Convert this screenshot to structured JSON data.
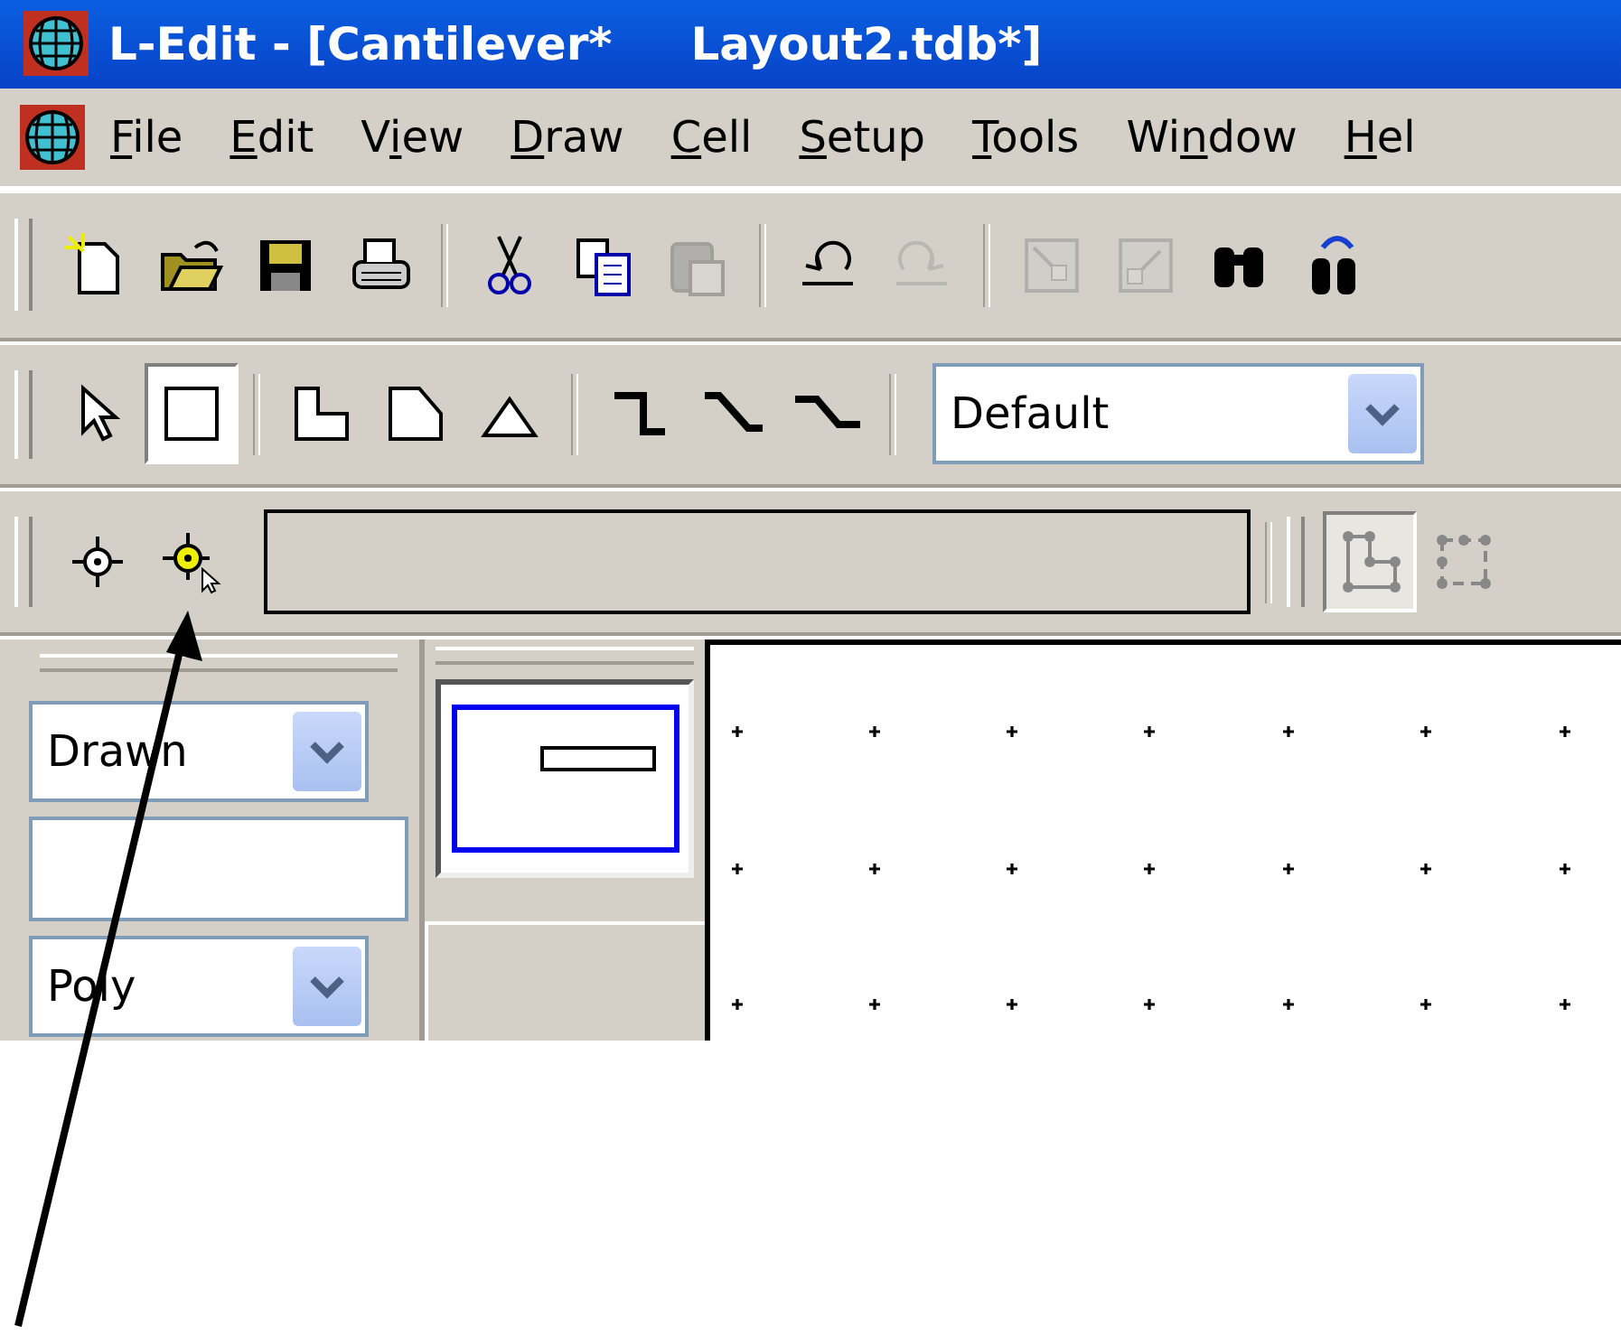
{
  "window": {
    "title": "L-Edit - [Cantilever*     Layout2.tdb*]"
  },
  "menu": [
    {
      "key": "F",
      "after": "ile"
    },
    {
      "key": "E",
      "after": "dit"
    },
    {
      "before": "V",
      "key": "i",
      "after": "ew"
    },
    {
      "key": "D",
      "after": "raw"
    },
    {
      "key": "C",
      "after": "ell"
    },
    {
      "key": "S",
      "after": "etup"
    },
    {
      "key": "T",
      "after": "ools"
    },
    {
      "before": "Wi",
      "key": "n",
      "after": "dow"
    },
    {
      "key": "H",
      "after": "el"
    }
  ],
  "standard_toolbar": {
    "groups": [
      [
        {
          "kind": "new",
          "disabled": false
        },
        {
          "kind": "open",
          "disabled": false
        },
        {
          "kind": "save",
          "disabled": false
        },
        {
          "kind": "print",
          "disabled": false
        }
      ],
      [
        {
          "kind": "cut",
          "disabled": false
        },
        {
          "kind": "copy",
          "disabled": false
        },
        {
          "kind": "paste",
          "disabled": true
        }
      ],
      [
        {
          "kind": "undo",
          "disabled": false
        },
        {
          "kind": "redo",
          "disabled": true
        }
      ],
      [
        {
          "kind": "push",
          "disabled": true
        },
        {
          "kind": "pop",
          "disabled": true
        },
        {
          "kind": "find",
          "disabled": false
        },
        {
          "kind": "find-next",
          "disabled": false
        }
      ]
    ]
  },
  "drawing_toolbar": {
    "groups": [
      [
        {
          "kind": "select",
          "selected": false
        },
        {
          "kind": "box",
          "selected": true
        }
      ],
      [
        {
          "kind": "orthogonal",
          "selected": false
        },
        {
          "kind": "angle45",
          "selected": false
        },
        {
          "kind": "triangle",
          "selected": false
        }
      ],
      [
        {
          "kind": "wire-ortho",
          "selected": false
        },
        {
          "kind": "wire-diag",
          "selected": false
        },
        {
          "kind": "wire-thin",
          "selected": false
        }
      ]
    ],
    "layer_dropdown": {
      "value": "Default"
    }
  },
  "locator_toolbar": {
    "buttons": [
      {
        "kind": "locator"
      },
      {
        "kind": "locator-cursor"
      }
    ]
  },
  "edit_toolbar": {
    "buttons": [
      {
        "kind": "edit-vertex",
        "selected": true
      },
      {
        "kind": "edit-edge",
        "selected": false
      }
    ]
  },
  "layer_panel": {
    "style_dropdown": {
      "value": "Drawn"
    },
    "type_dropdown": {
      "value": "Poly"
    }
  },
  "annotation": {
    "kind": "arrow"
  }
}
